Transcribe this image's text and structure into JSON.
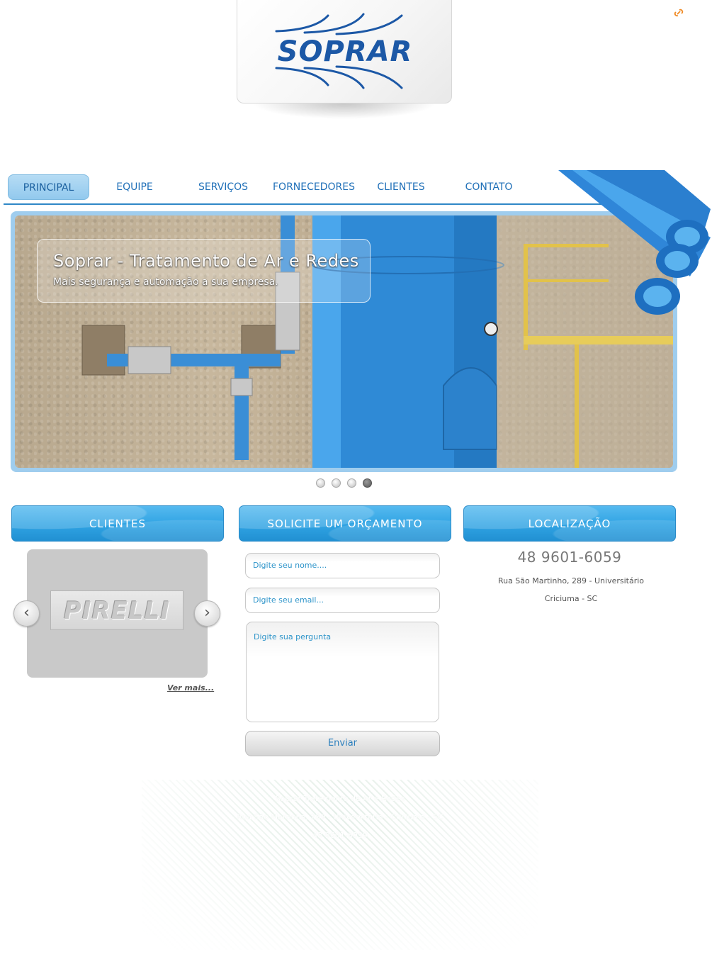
{
  "brand": {
    "logo_text": "SOPRAR",
    "color": "#1c58a6"
  },
  "top_icon": {
    "name": "link-icon",
    "color": "#f08a24"
  },
  "nav": {
    "items": [
      {
        "label": "PRINCIPAL",
        "active": true
      },
      {
        "label": "EQUIPE",
        "active": false
      },
      {
        "label": "SERVIÇOS",
        "active": false
      },
      {
        "label": "FORNECEDORES",
        "active": false
      },
      {
        "label": "CLIENTES",
        "active": false
      },
      {
        "label": "CONTATO",
        "active": false
      }
    ],
    "accent": "#2f88c7"
  },
  "slider": {
    "title": "Soprar - Tratamento de Ar e Redes",
    "subtitle": "Mais segurança e automação a sua empresa.",
    "slide_count": 4,
    "active_slide": 4
  },
  "clients": {
    "heading": "CLIENTES",
    "logo_text": "PIRELLI",
    "prev_icon": "chevron-left-icon",
    "next_icon": "chevron-right-icon",
    "more_link": "Ver mais..."
  },
  "quote_form": {
    "heading": "SOLICITE UM ORÇAMENTO",
    "name_placeholder": "Digite seu nome....",
    "email_placeholder": "Digite seu email...",
    "question_placeholder": "Digite sua pergunta",
    "submit_label": "Enviar"
  },
  "location": {
    "heading": "LOCALIZAÇÃO",
    "phone": "48 9601-6059",
    "address_line1": "Rua São Martinho, 289 - Universitário",
    "address_line2": "Criciuma - SC"
  },
  "footer": {
    "line1": "Soprar Tratamento de Ar e Redes",
    "line2": "Rua São Martinho, 289 - Universitário - Criciuma - SC",
    "line3": "48 9601-6059"
  },
  "colors": {
    "header_blue": "#2fa3e3",
    "text_blue": "#2b93c9"
  }
}
